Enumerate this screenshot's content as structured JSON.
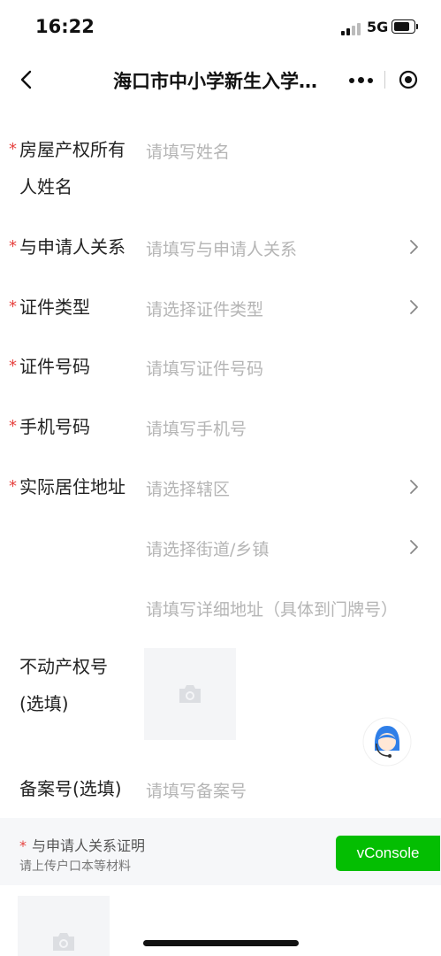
{
  "status_bar": {
    "time": "16:22",
    "network": "5G"
  },
  "nav": {
    "title": "海口市中小学新生入学…"
  },
  "form": {
    "owner_name": {
      "label_line1": "房屋产权所有",
      "label_line2": "人姓名",
      "placeholder": "请填写姓名"
    },
    "relation": {
      "label": "与申请人关系",
      "placeholder": "请填写与申请人关系"
    },
    "id_type": {
      "label": "证件类型",
      "placeholder": "请选择证件类型"
    },
    "id_number": {
      "label": "证件号码",
      "placeholder": "请填写证件号码"
    },
    "phone": {
      "label": "手机号码",
      "placeholder": "请填写手机号"
    },
    "address": {
      "label": "实际居住地址",
      "district_placeholder": "请选择辖区",
      "street_placeholder": "请选择街道/乡镇",
      "detail_placeholder": "请填写详细地址（具体到门牌号）"
    },
    "property_cert": {
      "label_line1": "不动产权号",
      "label_line2": "(选填)"
    },
    "record_number": {
      "label": "备案号(选填)",
      "placeholder": "请填写备案号"
    }
  },
  "proof_section": {
    "title": "与申请人关系证明",
    "subtitle": "请上传户口本等材料"
  },
  "vconsole_label": "vConsole",
  "colors": {
    "required": "#e64340",
    "vconsole": "#04be02",
    "placeholder": "#b5b5b5"
  }
}
